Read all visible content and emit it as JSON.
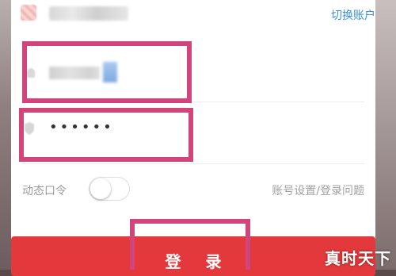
{
  "header": {
    "switch_account_label": "切换账户"
  },
  "login_form": {
    "password_masked": "••••••",
    "dynamic_password_label": "动态口令",
    "dynamic_password_enabled": false,
    "help_link_label": "账号设置/登录问题",
    "login_button_label": "登 录"
  },
  "watermark": "真时天下",
  "colors": {
    "accent_red": "#e4393c",
    "link_blue": "#3b8fd9",
    "annotation_pink": "#d1457a"
  },
  "icons": [
    "avatar",
    "user-icon",
    "shield-icon"
  ]
}
